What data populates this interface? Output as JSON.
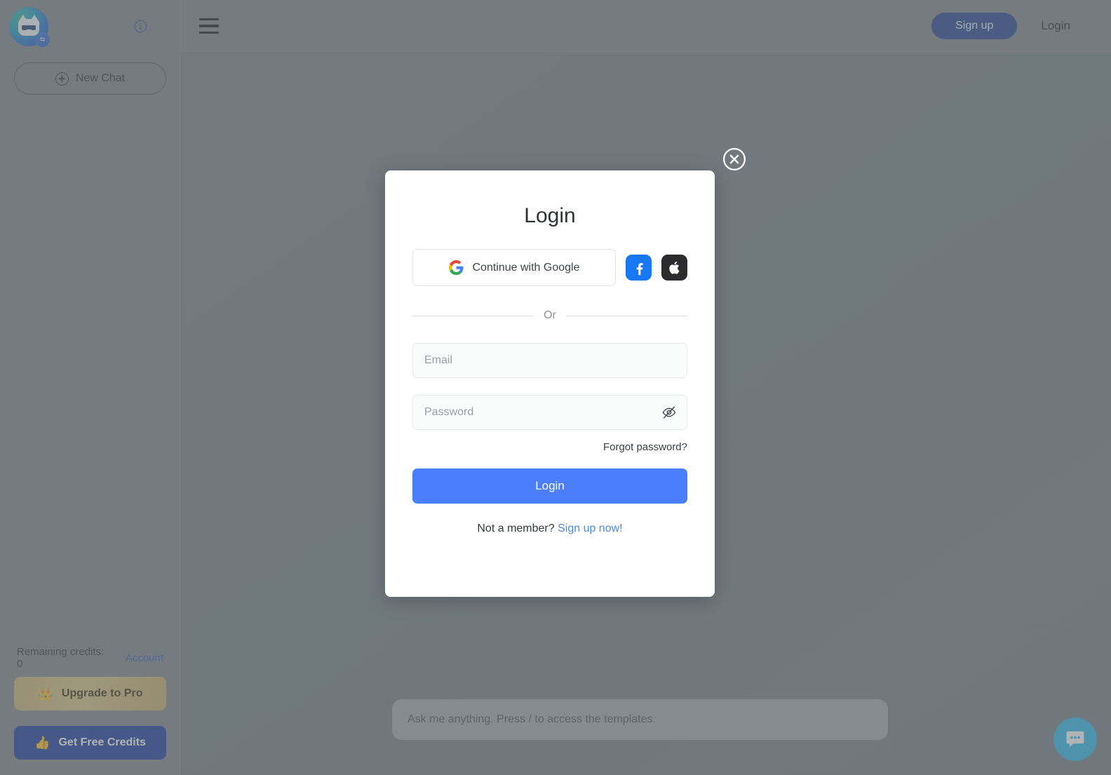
{
  "sidebar": {
    "logo_alt": "robot-cat-logo",
    "info_tooltip": "i",
    "new_chat_label": "New Chat",
    "credits_label": "Remaining credits: 0",
    "account_label": "Account",
    "upgrade_label": "Upgrade to Pro",
    "upgrade_emoji": "👑",
    "free_credits_label": "Get Free Credits",
    "free_credits_emoji": "👍"
  },
  "header": {
    "signup_label": "Sign up",
    "login_label": "Login",
    "signup_color": "#1f3f8f"
  },
  "canvas": {
    "chat_placeholder": "Ask me anything. Press / to access the templates.",
    "chat_widget_color": "#29b6e8"
  },
  "modal": {
    "title": "Login",
    "google_label": "Continue with Google",
    "facebook_label": "Facebook",
    "apple_label": "Apple",
    "divider_label": "Or",
    "email_placeholder": "Email",
    "email_value": "",
    "password_placeholder": "Password",
    "password_value": "",
    "password_visible": false,
    "forgot_label": "Forgot password?",
    "submit_label": "Login",
    "member_prompt": "Not a member?",
    "signup_now_label": "Sign up now!",
    "accent_color": "#4a7efc",
    "link_color": "#4a8ae8"
  }
}
